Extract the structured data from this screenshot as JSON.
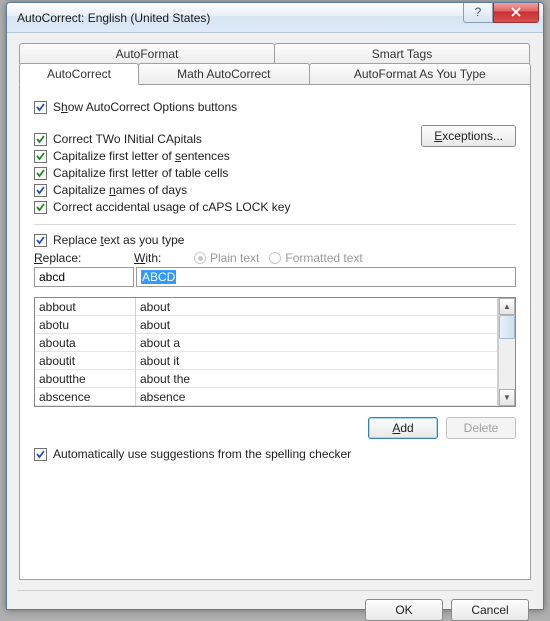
{
  "title": "AutoCorrect: English (United States)",
  "tabs": {
    "autoformat": "AutoFormat",
    "smart_tags": "Smart Tags",
    "autocorrect": "AutoCorrect",
    "math_autocorrect": "Math AutoCorrect",
    "autoformat_type": "AutoFormat As You Type"
  },
  "options": {
    "show_buttons_pre": "S",
    "show_buttons_u": "h",
    "show_buttons_post": "ow AutoCorrect Options buttons",
    "two_initial": "Correct TWo INitial CApitals",
    "first_sentence_pre": "Capitalize first letter of ",
    "first_sentence_u": "s",
    "first_sentence_post": "entences",
    "table_cells": "Capitalize first letter of table cells",
    "names_days_pre": "Capitalize ",
    "names_days_u": "n",
    "names_days_post": "ames of days",
    "caps_lock": "Correct accidental usage of cAPS LOCK key",
    "replace_as_type_pre": "Replace ",
    "replace_as_type_u": "t",
    "replace_as_type_post": "ext as you type",
    "auto_spell_pre": "Automatically use su",
    "auto_spell_u": "g",
    "auto_spell_post": "gestions from the spelling checker"
  },
  "buttons": {
    "exceptions": "Exceptions...",
    "add": "Add",
    "delete": "Delete",
    "ok": "OK",
    "cancel": "Cancel"
  },
  "labels": {
    "replace_u": "R",
    "replace_post": "eplace:",
    "with_u": "W",
    "with_post": "ith:",
    "plain_text": "Plain text",
    "formatted_text": "Formatted text"
  },
  "inputs": {
    "replace_value": "abcd",
    "with_value": "ABCD"
  },
  "list": [
    {
      "from": "abbout",
      "to": "about"
    },
    {
      "from": "abotu",
      "to": "about"
    },
    {
      "from": "abouta",
      "to": "about a"
    },
    {
      "from": "aboutit",
      "to": "about it"
    },
    {
      "from": "aboutthe",
      "to": "about the"
    },
    {
      "from": "abscence",
      "to": "absence"
    }
  ]
}
